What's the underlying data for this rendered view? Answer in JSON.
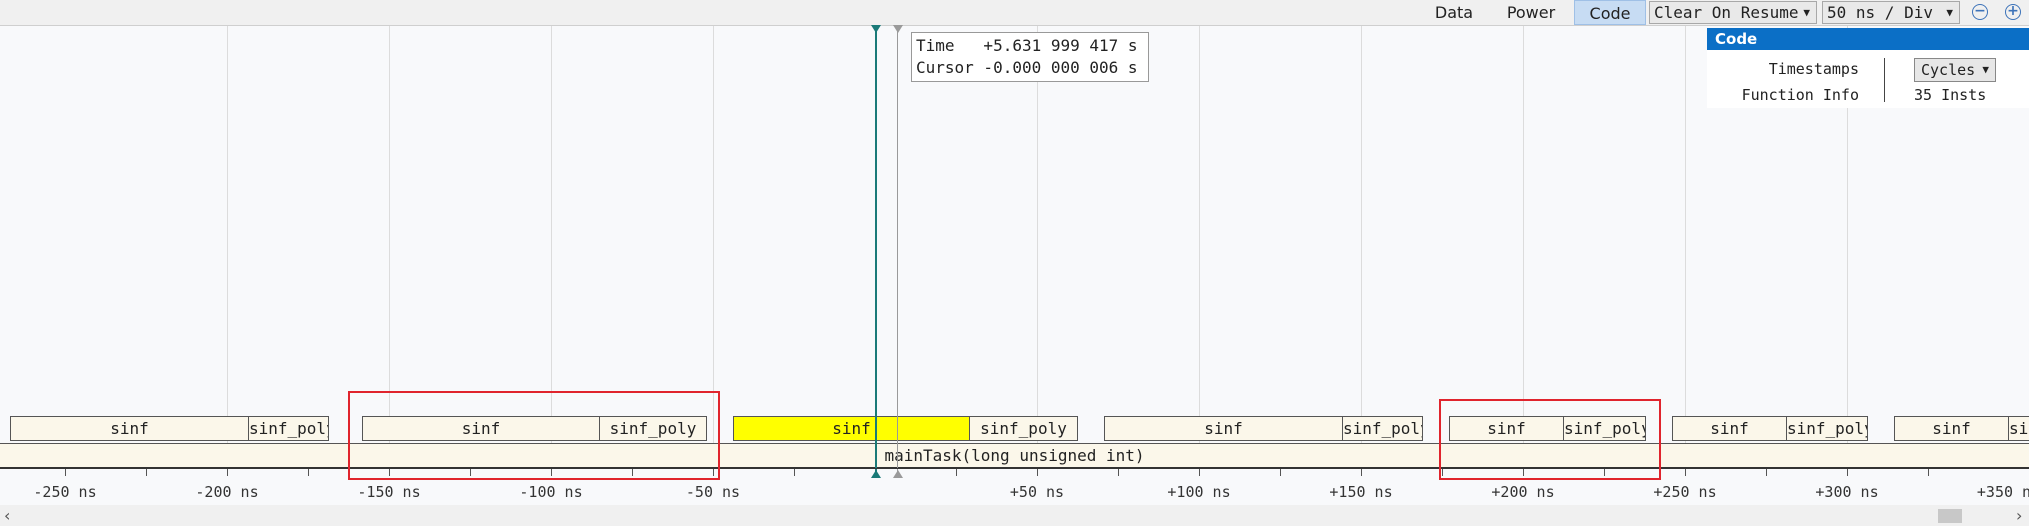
{
  "toolbar": {
    "tabs": [
      "Data",
      "Power",
      "Code"
    ],
    "active_tab": "Code",
    "mode_select": "Clear On Resume",
    "scale_select": "50 ns / Div"
  },
  "tooltip": {
    "line1": "Time   +5.631 999 417 s",
    "line2": "Cursor -0.000 000 006 s"
  },
  "code_panel": {
    "title": "Code",
    "rows": [
      {
        "label": "Timestamps",
        "value": "Cycles"
      },
      {
        "label": "Function Info",
        "value": "35 Insts"
      }
    ]
  },
  "timeline": {
    "main_label": "mainTask(long unsigned int)",
    "blocks": [
      {
        "label": "sinf"
      },
      {
        "label": "sinf_poly"
      },
      {
        "label": "sinf"
      },
      {
        "label": "sinf_poly"
      },
      {
        "label": "sinf",
        "highlight": true
      },
      {
        "label": "sinf_poly"
      },
      {
        "label": "sinf"
      },
      {
        "label": "sinf_poly"
      },
      {
        "label": "sinf"
      },
      {
        "label": "sinf_poly"
      },
      {
        "label": "sinf"
      },
      {
        "label": "sinf_poly"
      },
      {
        "label": "sinf"
      },
      {
        "label": "sin"
      }
    ]
  },
  "axis": {
    "labels": [
      "-250 ns",
      "-200 ns",
      "-150 ns",
      "-100 ns",
      "-50 ns",
      "+50 ns",
      "+100 ns",
      "+150 ns",
      "+200 ns",
      "+250 ns",
      "+300 ns",
      "+350 n"
    ]
  },
  "colors": {
    "accent": "#0b6fc6",
    "highlight": "#ffff00",
    "annotation": "#e0242d",
    "cursor_teal": "#1a7a78"
  }
}
